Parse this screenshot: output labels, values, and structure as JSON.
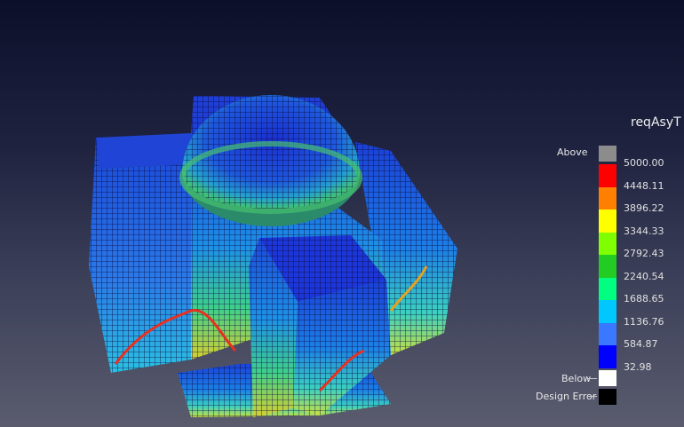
{
  "legend": {
    "title": "reqAsyT",
    "above_label": "Above",
    "below_label": "Below",
    "error_label": "Design Error",
    "values": [
      "5000.00",
      "4448.11",
      "3896.22",
      "3344.33",
      "2792.43",
      "2240.54",
      "1688.65",
      "1136.76",
      "584.87",
      "32.98"
    ],
    "colors": {
      "above": "#8c8c8c",
      "below": "#ffffff",
      "error": "#000000",
      "bands": [
        "#ff0000",
        "#ff8000",
        "#ffff00",
        "#80ff00",
        "#22cc22",
        "#00ff80",
        "#00c8ff",
        "#3a78ff",
        "#0000ff"
      ]
    }
  },
  "scene": {
    "description_icon": "structure-mesh-icon"
  }
}
